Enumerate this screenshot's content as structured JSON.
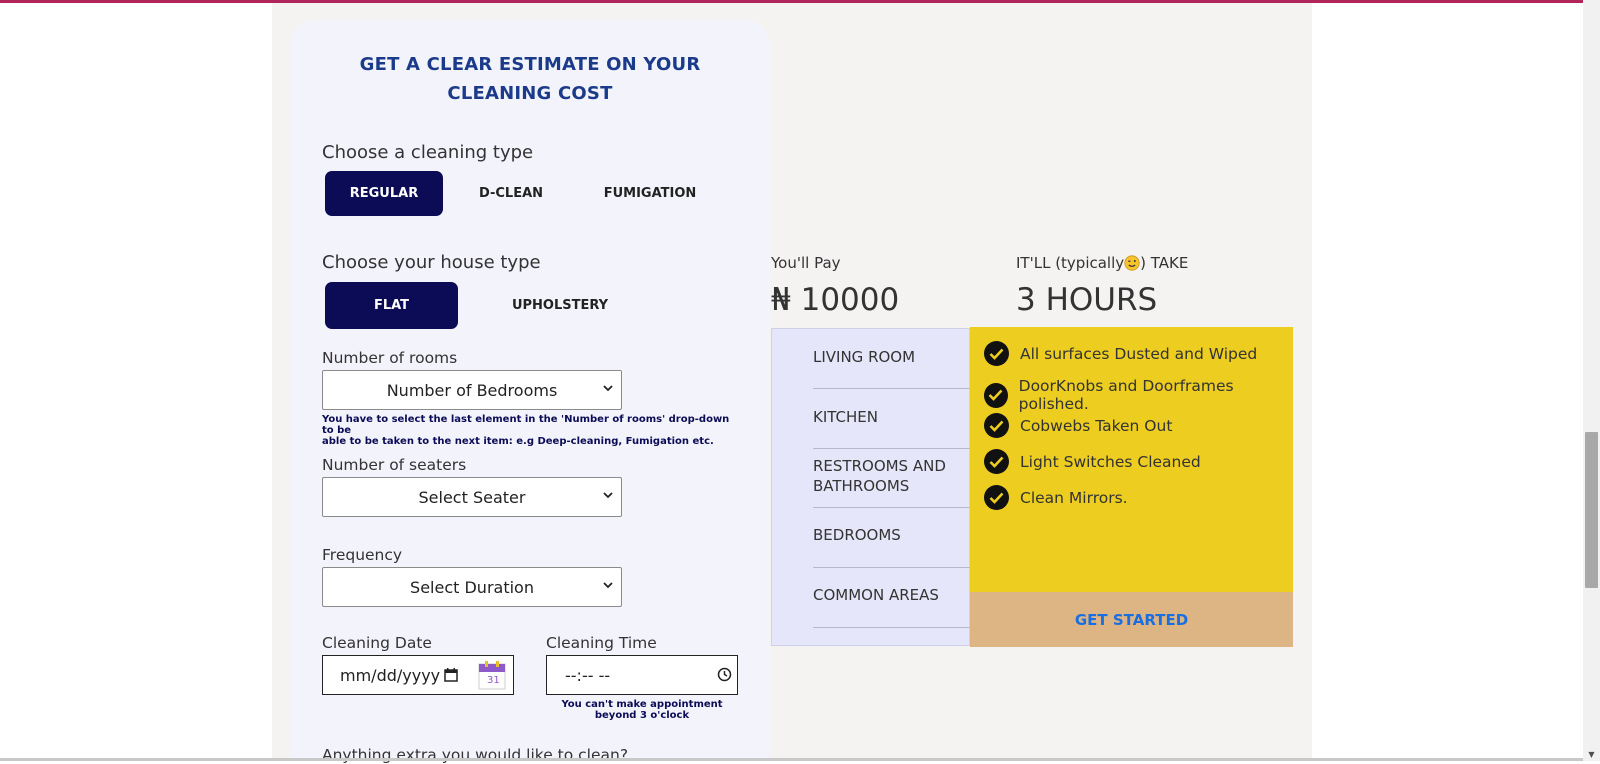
{
  "form": {
    "title_line1": "GET A CLEAR ESTIMATE ON YOUR",
    "title_line2": "CLEANING COST",
    "cleaning_type_label": "Choose a cleaning type",
    "cleaning_types": [
      "REGULAR",
      "D-CLEAN",
      "FUMIGATION"
    ],
    "house_type_label": "Choose your house type",
    "house_types": [
      "FLAT",
      "UPHOLSTERY"
    ],
    "rooms_label": "Number of rooms",
    "rooms_select": "Number of Bedrooms",
    "rooms_hint_line1": "You have to select the last element in the 'Number of rooms' drop-down to be",
    "rooms_hint_line2": "able to be taken to the next item: e.g Deep-cleaning, Fumigation etc.",
    "seaters_label": "Number of seaters",
    "seaters_select": "Select Seater",
    "frequency_label": "Frequency",
    "frequency_select": "Select Duration",
    "date_label": "Cleaning Date",
    "date_value": "mm/dd/yyyy",
    "calendar_day": "31",
    "time_label": "Cleaning Time",
    "time_value": "--:-- --",
    "time_hint_line1": "You can't make appointment",
    "time_hint_line2": "beyond 3 o'clock",
    "extra_label": "Anything extra you would like to clean?"
  },
  "summary": {
    "pay_label": "You'll Pay",
    "currency_symbol": "₦",
    "amount": "10000",
    "duration_label_pre": "IT'LL (typically",
    "duration_label_post": ") TAKE",
    "duration_value": "3 HOURS"
  },
  "rooms": [
    "LIVING ROOM",
    "KITCHEN",
    "RESTROOMS AND BATHROOMS",
    "BEDROOMS",
    "COMMON AREAS"
  ],
  "checklist": [
    "All surfaces Dusted and Wiped",
    "DoorKnobs and Doorframes polished.",
    "Cobwebs Taken Out",
    "Light Switches Cleaned",
    "Clean Mirrors."
  ],
  "cta": {
    "label": "GET STARTED"
  },
  "colors": {
    "accent_dark": "#0c0c56",
    "title_blue": "#1b3b8a",
    "checklist_bg": "#eccd20",
    "cta_bg": "#ddb584",
    "cta_text": "#1a6fe0",
    "top_bar": "#b0265a"
  }
}
